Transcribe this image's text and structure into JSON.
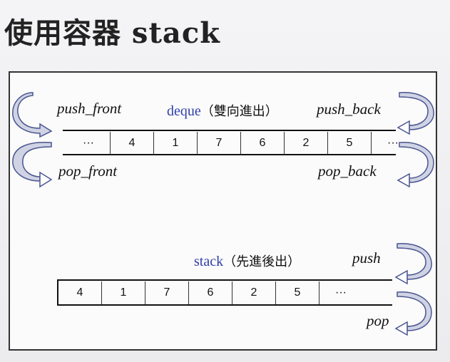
{
  "slide": {
    "title": "使用容器 stack"
  },
  "deque": {
    "name": "deque",
    "note": "（雙向進出）",
    "push_front": "push_front",
    "push_back": "push_back",
    "pop_front": "pop_front",
    "pop_back": "pop_back",
    "cells": [
      "···",
      "4",
      "1",
      "7",
      "6",
      "2",
      "5",
      "···"
    ]
  },
  "stack": {
    "name": "stack",
    "note": "（先進後出）",
    "push": "push",
    "pop": "pop",
    "cells": [
      "4",
      "1",
      "7",
      "6",
      "2",
      "5",
      "···"
    ]
  },
  "colors": {
    "caption": "#3040a8",
    "arrow_fill": "#cfd3e4",
    "arrow_stroke": "#4a5590"
  },
  "icons": [
    "curved-arrow-icon"
  ]
}
